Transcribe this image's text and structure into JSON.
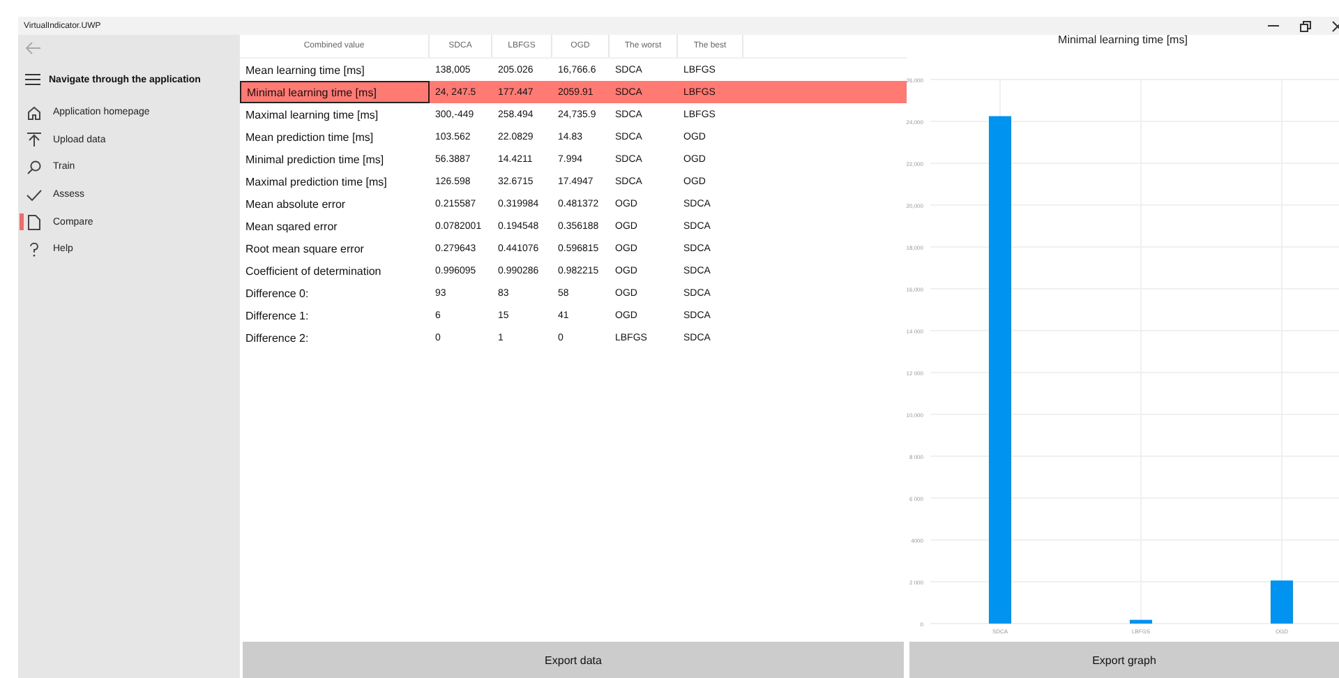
{
  "window": {
    "title": "VirtualIndicator.UWP"
  },
  "sidebar": {
    "header": "Navigate through the application",
    "items": [
      {
        "label": "Application homepage",
        "selected": false
      },
      {
        "label": "Upload data",
        "selected": false
      },
      {
        "label": "Train",
        "selected": false
      },
      {
        "label": "Assess",
        "selected": false
      },
      {
        "label": "Compare",
        "selected": true
      },
      {
        "label": "Help",
        "selected": false
      }
    ]
  },
  "table": {
    "columns": [
      "Combined value",
      "SDCA",
      "LBFGS",
      "OGD",
      "The worst",
      "The best"
    ],
    "rows": [
      {
        "cells": [
          "Mean learning time [ms]",
          "138,005",
          "205.026",
          "16,766.6",
          "SDCA",
          "LBFGS"
        ],
        "selected": false
      },
      {
        "cells": [
          "Minimal learning time [ms]",
          "24, 247.5",
          "177.447",
          "2059.91",
          "SDCA",
          "LBFGS"
        ],
        "selected": true
      },
      {
        "cells": [
          "Maximal learning time [ms]",
          "300,-449",
          "258.494",
          "24,735.9",
          "SDCA",
          "LBFGS"
        ],
        "selected": false
      },
      {
        "cells": [
          "Mean prediction time [ms]",
          "103.562",
          "22.0829",
          "14.83",
          "SDCA",
          "OGD"
        ],
        "selected": false
      },
      {
        "cells": [
          "Minimal prediction time [ms]",
          "56.3887",
          "14.4211",
          "7.994",
          "SDCA",
          "OGD"
        ],
        "selected": false
      },
      {
        "cells": [
          "Maximal prediction time [ms]",
          "126.598",
          "32.6715",
          "17.4947",
          "SDCA",
          "OGD"
        ],
        "selected": false
      },
      {
        "cells": [
          "Mean absolute error",
          "0.215587",
          "0.319984",
          "0.481372",
          "OGD",
          "SDCA"
        ],
        "selected": false
      },
      {
        "cells": [
          "Mean sqared error",
          "0.0782001",
          "0.194548",
          "0.356188",
          "OGD",
          "SDCA"
        ],
        "selected": false
      },
      {
        "cells": [
          "Root mean square error",
          "0.279643",
          "0.441076",
          "0.596815",
          "OGD",
          "SDCA"
        ],
        "selected": false
      },
      {
        "cells": [
          "Coefficient of determination",
          "0.996095",
          "0.990286",
          "0.982215",
          "OGD",
          "SDCA"
        ],
        "selected": false
      },
      {
        "cells": [
          "Difference 0:",
          "93",
          "83",
          "58",
          "OGD",
          "SDCA"
        ],
        "selected": false
      },
      {
        "cells": [
          "Difference 1:",
          "6",
          "15",
          "41",
          "OGD",
          "SDCA"
        ],
        "selected": false
      },
      {
        "cells": [
          "Difference 2:",
          "0",
          "1",
          "0",
          "LBFGS",
          "SDCA"
        ],
        "selected": false
      }
    ]
  },
  "export_data_button": "Export data",
  "graph": {
    "chart_data": {
      "type": "bar",
      "title": "Minimal learning time [ms]",
      "categories": [
        "SDCA",
        "LBFGS",
        "OGD"
      ],
      "series": [
        {
          "color": "#0094f0",
          "values": [
            24250,
            180,
            2060
          ]
        }
      ],
      "ylim": [
        0,
        26000
      ],
      "grid": true,
      "yticks": [
        {
          "value": 0,
          "label": "0"
        },
        {
          "value": 2000,
          "label": "2 000"
        },
        {
          "value": 4000,
          "label": "4000"
        },
        {
          "value": 6000,
          "label": "6 000"
        },
        {
          "value": 8000,
          "label": "8 000"
        },
        {
          "value": 10000,
          "label": "10,000"
        },
        {
          "value": 12000,
          "label": "12 000"
        },
        {
          "value": 14000,
          "label": "14 000"
        },
        {
          "value": 16000,
          "label": "16,000"
        },
        {
          "value": 18000,
          "label": "18,000"
        },
        {
          "value": 20000,
          "label": "20,000"
        },
        {
          "value": 22000,
          "label": "22,000"
        },
        {
          "value": 24000,
          "label": "24,000"
        },
        {
          "value": 26000,
          "label": "26,000"
        }
      ]
    },
    "export_button": "Export graph"
  }
}
